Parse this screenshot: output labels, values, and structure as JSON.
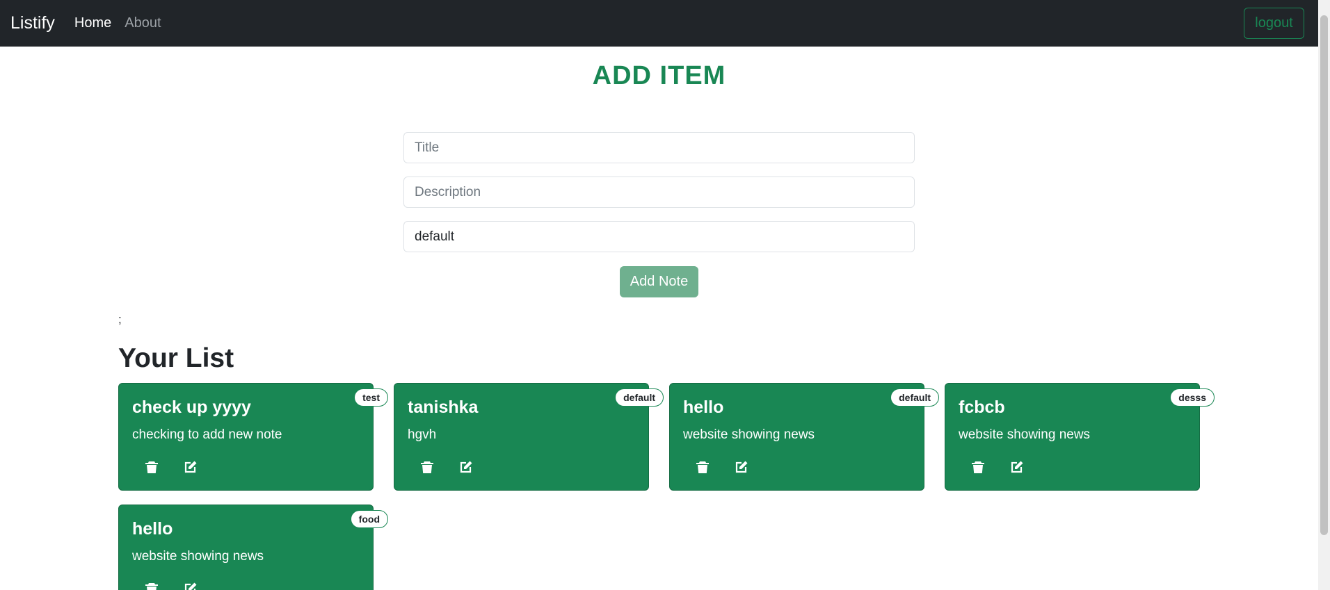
{
  "navbar": {
    "brand": "Listify",
    "links": [
      "Home",
      "About"
    ],
    "logout_label": "logout"
  },
  "form": {
    "heading": "ADD ITEM",
    "title_placeholder": "Title",
    "description_placeholder": "Description",
    "tag_value": "default",
    "submit_label": "Add Note"
  },
  "stray_text": ";",
  "list": {
    "heading": "Your List",
    "notes": [
      {
        "title": "check up yyyy",
        "description": "checking to add new note",
        "tag": "test"
      },
      {
        "title": "tanishka",
        "description": "hgvh",
        "tag": "default"
      },
      {
        "title": "hello",
        "description": "website showing news",
        "tag": "default"
      },
      {
        "title": "fcbcb",
        "description": "website showing news",
        "tag": "desss"
      },
      {
        "title": "hello",
        "description": "website showing news",
        "tag": "food"
      }
    ]
  },
  "icons": {
    "delete": "trash-icon",
    "edit": "edit-icon"
  },
  "colors": {
    "navbar_bg": "#212529",
    "accent_green": "#198754",
    "button_disabled_green": "#6fb08f"
  }
}
